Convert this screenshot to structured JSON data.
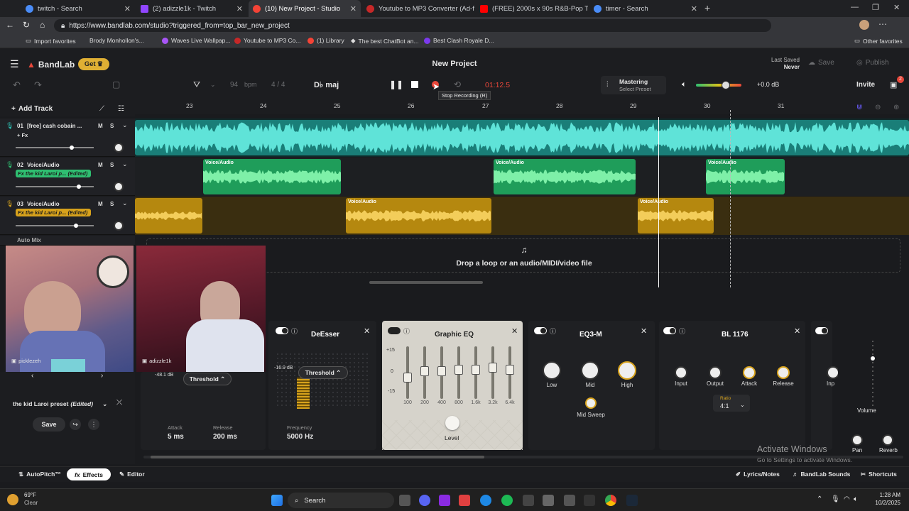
{
  "browser": {
    "tabs": [
      {
        "title": "twitch - Search",
        "active": false,
        "color": "#4a8cf7"
      },
      {
        "title": "(2) adizzle1k - Twitch",
        "active": false,
        "color": "#9146ff"
      },
      {
        "title": "(10) New Project - Studio",
        "active": true,
        "color": "#f44336"
      },
      {
        "title": "Youtube to MP3 Converter (Ad-fr",
        "active": false,
        "color": "#c62828"
      },
      {
        "title": "(FREE) 2000s x 90s R&B-Pop Type",
        "active": false,
        "color": "#ff0000"
      },
      {
        "title": "timer - Search",
        "active": false,
        "color": "#4a8cf7"
      }
    ],
    "url": "https://www.bandlab.com/studio?triggered_from=top_bar_new_project",
    "bookmarks": [
      "Import favorites",
      "Brody Monhollon's...",
      "Waves Live Wallpap...",
      "Youtube to MP3 Co...",
      "(1) Library",
      "The best ChatBot an...",
      "Best Clash Royale D..."
    ],
    "other_favorites": "Other favorites"
  },
  "app": {
    "logo": "BandLab",
    "get_label": "Get",
    "project_title": "New Project",
    "last_saved_label": "Last Saved",
    "last_saved_value": "Never",
    "save_label": "Save",
    "publish_label": "Publish",
    "tempo": "94",
    "bpm_label": "bpm",
    "time_sig": "4 / 4",
    "key": "D♭ maj",
    "time": "01:12.5",
    "tooltip": "Stop Recording (R)",
    "mastering_title": "Mastering",
    "mastering_sub": "Select Preset",
    "volume_db": "+0.0 dB",
    "invite_label": "Invite",
    "notif_count": "2",
    "accent": "#e8473a"
  },
  "timeline": {
    "add_track": "Add Track",
    "ruler": [
      "23",
      "24",
      "25",
      "26",
      "27",
      "28",
      "29",
      "30",
      "31"
    ],
    "tracks": [
      {
        "num": "01",
        "name": "[free] cash cobain ...",
        "fx": "+ Fx",
        "color": "#2ec4b6"
      },
      {
        "num": "02",
        "name": "Voice/Audio",
        "fx": "Fx the kid Laroi p...",
        "edited": "(Edited)",
        "color": "#2fbf71"
      },
      {
        "num": "03",
        "name": "Voice/Audio",
        "fx": "Fx the kid Laroi p...",
        "edited": "(Edited)",
        "color": "#d7a21c"
      }
    ],
    "clip_label": "Voice/Audio",
    "drop_text": "Drop a loop or an audio/MIDI/video file",
    "ms_m": "M",
    "ms_s": "S",
    "track4_partial": "Auto Mix"
  },
  "streamers": {
    "left_name": "picklezeh",
    "right_name": "adizzle1k"
  },
  "fx": {
    "preset_name": "the kid Laroi preset",
    "preset_edited": "(Edited)",
    "save": "Save",
    "compressor": {
      "threshold_db": "-48.1 dB",
      "threshold_label": "Threshold",
      "attack_label": "Attack",
      "attack_val": "5 ms",
      "release_label": "Release",
      "release_val": "200 ms"
    },
    "deesser": {
      "title": "DeEsser",
      "threshold_db": "-16.9 dB",
      "threshold_label": "Threshold",
      "freq_label": "Frequency",
      "freq_val": "5000 Hz"
    },
    "geq": {
      "title": "Graphic EQ",
      "scale": [
        "+15",
        "0",
        "-15"
      ],
      "bands": [
        "100",
        "200",
        "400",
        "800",
        "1.6k",
        "3.2k",
        "6.4k"
      ],
      "levels": [
        -3,
        1,
        1,
        2,
        2,
        3,
        2
      ],
      "level_label": "Level"
    },
    "eq3": {
      "title": "EQ3-M",
      "low": "Low",
      "mid": "Mid",
      "high": "High",
      "mid_sweep": "Mid Sweep"
    },
    "bl1176": {
      "title": "BL 1176",
      "input": "Input",
      "output": "Output",
      "attack": "Attack",
      "release": "Release",
      "ratio_label": "Ratio",
      "ratio_val": "4:1"
    },
    "partial_label": "Inp",
    "volume_label": "Volume",
    "pan_label": "Pan",
    "reverb_label": "Reverb"
  },
  "bottom": {
    "autopitch": "AutoPitch™",
    "effects": "Effects",
    "editor": "Editor",
    "lyrics": "Lyrics/Notes",
    "sounds": "BandLab Sounds",
    "shortcuts": "Shortcuts"
  },
  "watermark": {
    "line1": "Activate Windows",
    "line2": "Go to Settings to activate Windows."
  },
  "taskbar": {
    "temp": "69°F",
    "weather": "Clear",
    "search": "Search",
    "time": "1:28 AM",
    "date": "10/2/2025"
  }
}
